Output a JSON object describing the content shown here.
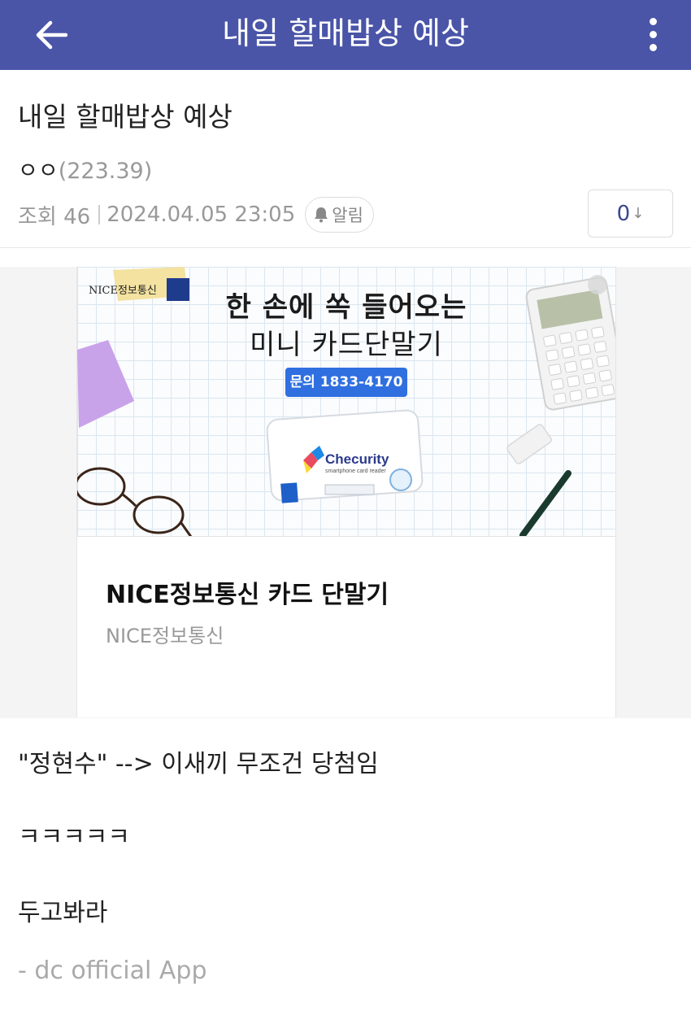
{
  "appbar": {
    "title": "내일 할매밥상 예상",
    "back_icon": "arrow-left-icon",
    "more_icon": "more-vertical-icon",
    "color": "#4a55a8"
  },
  "post": {
    "title": "내일 할매밥상 예상",
    "author_nick": "ㅇㅇ",
    "author_ip": "(223.39)",
    "views": "조회 46",
    "datetime": "2024.04.05 23:05",
    "alarm_label": "알림",
    "alarm_icon": "bell-icon",
    "vote_count": "0",
    "vote_icon": "arrow-down-icon"
  },
  "ad": {
    "banner_brand": "NICE정보통신",
    "banner_logo_letters": [
      "N",
      "I",
      "C",
      "E"
    ],
    "headline1": "한 손에 쏙 들어오는",
    "headline2": "미니 카드단말기",
    "phone": "문의 1833-4170",
    "product_name": "Checurity",
    "product_sub": "smartphone card reader",
    "title": "NICE정보통신 카드 단말기",
    "sponsor": "NICE정보통신"
  },
  "body": {
    "lines": [
      "\"정현수\" --> 이새끼 무조건 당첨임",
      "ㅋㅋㅋㅋㅋ",
      "두고봐라"
    ],
    "signature": "- dc official App"
  }
}
